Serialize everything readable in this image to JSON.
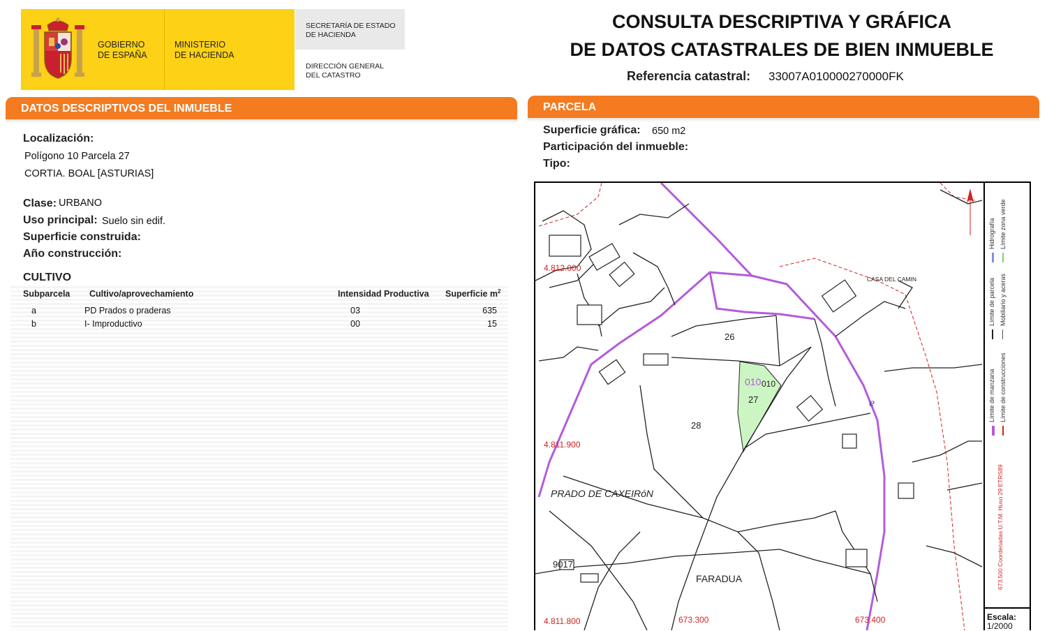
{
  "header": {
    "gov_line1": "GOBIERNO",
    "gov_line2": "DE ESPAÑA",
    "ministry_line1": "MINISTERIO",
    "ministry_line2": "DE HACIENDA",
    "secretaria_line1": "SECRETARÍA DE ESTADO",
    "secretaria_line2": "DE HACIENDA",
    "direccion_line1": "DIRECCIÓN GENERAL",
    "direccion_line2": "DEL CATASTRO",
    "title_line1": "CONSULTA DESCRIPTIVA Y GRÁFICA",
    "title_line2": "DE DATOS CATASTRALES DE BIEN INMUEBLE",
    "ref_label": "Referencia catastral:",
    "ref_value": "33007A010000270000FK",
    "logo_color": "#fcd116",
    "accent_color": "#f47b20"
  },
  "descriptivos": {
    "section_title": "DATOS DESCRIPTIVOS DEL INMUEBLE",
    "localizacion_label": "Localización:",
    "localizacion_line1": "Polígono 10 Parcela 27",
    "localizacion_line2": "CORTIA. BOAL [ASTURIAS]",
    "clase_label": "Clase:",
    "clase_value": "URBANO",
    "uso_label": "Uso principal:",
    "uso_value": "Suelo sin edif.",
    "superficie_label": "Superficie construida:",
    "ano_label": "Año construcción:",
    "cultivo_title": "CULTIVO",
    "cultivo_headers": {
      "subparcela": "Subparcela",
      "cultivo": "Cultivo/aprovechamiento",
      "intensidad": "Intensidad Productiva",
      "superficie": "Superficie m",
      "superficie_sup": "2"
    },
    "cultivo_rows": [
      {
        "sub": "a",
        "cultivo": "PD Prados o praderas",
        "intensidad": "03",
        "superficie": "635"
      },
      {
        "sub": "b",
        "cultivo": "I- Improductivo",
        "intensidad": "00",
        "superficie": "15"
      }
    ]
  },
  "parcela": {
    "section_title": "PARCELA",
    "superficie_label": "Superficie gráfica:",
    "superficie_value": "650 m2",
    "participacion_label": "Participación del inmueble:",
    "tipo_label": "Tipo:"
  },
  "map": {
    "coord_y_top": "4.812.000",
    "coord_y_mid": "4.811.900",
    "coord_y_bottom": "4.811.800",
    "coord_x_left": "673.300",
    "coord_x_right": "673.400",
    "place_casa": "CASA DEL CAMIN",
    "place_prado": "PRADO DE CAXEIRóN",
    "place_faradua": "FARADUA",
    "parcel_26": "26",
    "parcel_27": "27",
    "parcel_28": "28",
    "parcel_010_purple": "010",
    "parcel_010_black": "010",
    "parcel_9017": "9017",
    "legend_hidro": "Hidrografía",
    "legend_zona_verde": "Límite zona verde",
    "legend_parcela": "Límite de parcela",
    "legend_mobiliario": "Mobiliario y aceras",
    "legend_manzana": "Límite de manzana",
    "legend_construcciones": "Límite de construcciones",
    "legend_coords": "673.500 Coordenadas U.T.M. Huso 29 ETRS89",
    "escala_label": "Escala:",
    "escala_value": "1/2000",
    "parcel_fill": "#ccf5c4",
    "road_color": "#b35cd9",
    "coord_color": "#d22222"
  }
}
